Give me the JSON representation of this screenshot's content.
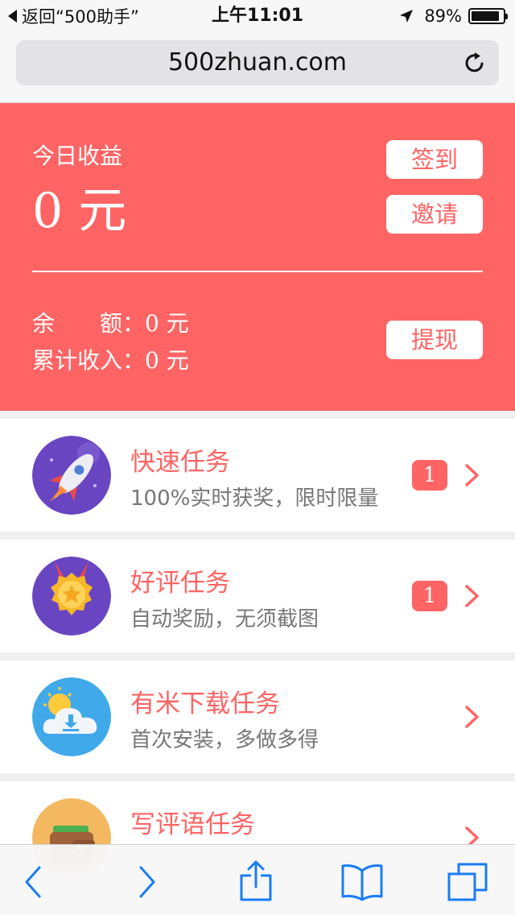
{
  "status_bar": {
    "back_label": "返回“500助手”",
    "time": "上午11:01",
    "battery_text": "89%",
    "battery_level": 0.89
  },
  "browser": {
    "url": "500zhuan.com"
  },
  "earnings": {
    "today_label": "今日收益",
    "today_value": "0 元",
    "sign_in_button": "签到",
    "invite_button": "邀请",
    "balance_label": "余　　额：",
    "balance_value": "0 元",
    "total_income_label": "累计收入：",
    "total_income_value": "0 元",
    "withdraw_button": "提现"
  },
  "tasks": [
    {
      "title": "快速任务",
      "subtitle": "100%实时获奖，限时限量",
      "badge": "1",
      "icon": "rocket-icon"
    },
    {
      "title": "好评任务",
      "subtitle": "自动奖励，无须截图",
      "badge": "1",
      "icon": "medal-icon"
    },
    {
      "title": "有米下载任务",
      "subtitle": "首次安装，多做多得",
      "badge": "",
      "icon": "cloud-download-icon"
    },
    {
      "title": "写评语任务",
      "subtitle": "",
      "badge": "",
      "icon": "wallet-icon"
    }
  ],
  "colors": {
    "accent": "#ff6464",
    "ios_blue": "#1a7cf5"
  }
}
